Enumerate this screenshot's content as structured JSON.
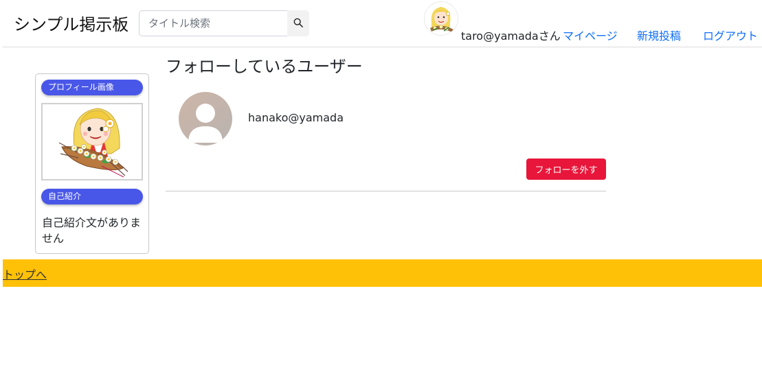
{
  "header": {
    "brand": "シンプル掲示板",
    "search": {
      "placeholder": "タイトル検索",
      "value": ""
    },
    "user_label": "taro@yamadaさん",
    "links": {
      "mypage": "マイページ",
      "new_post": "新規投稿",
      "logout": "ログアウト"
    }
  },
  "sidebar": {
    "profile_image_label": "プロフィール画像",
    "intro_label": "自己紹介",
    "intro_text": "自己紹介文がありません"
  },
  "main": {
    "title": "フォローしているユーザー",
    "followed_users": [
      {
        "name": "hanako@yamada",
        "unfollow_label": "フォローを外す"
      }
    ]
  },
  "footer": {
    "top_link": "トップへ"
  },
  "colors": {
    "accent_pill": "#4957e8",
    "link": "#0d6efd",
    "danger": "#e8163a",
    "footer_bg": "#ffc107"
  },
  "icons": [
    "search-icon",
    "user-avatar-icon",
    "profile-illustration"
  ]
}
